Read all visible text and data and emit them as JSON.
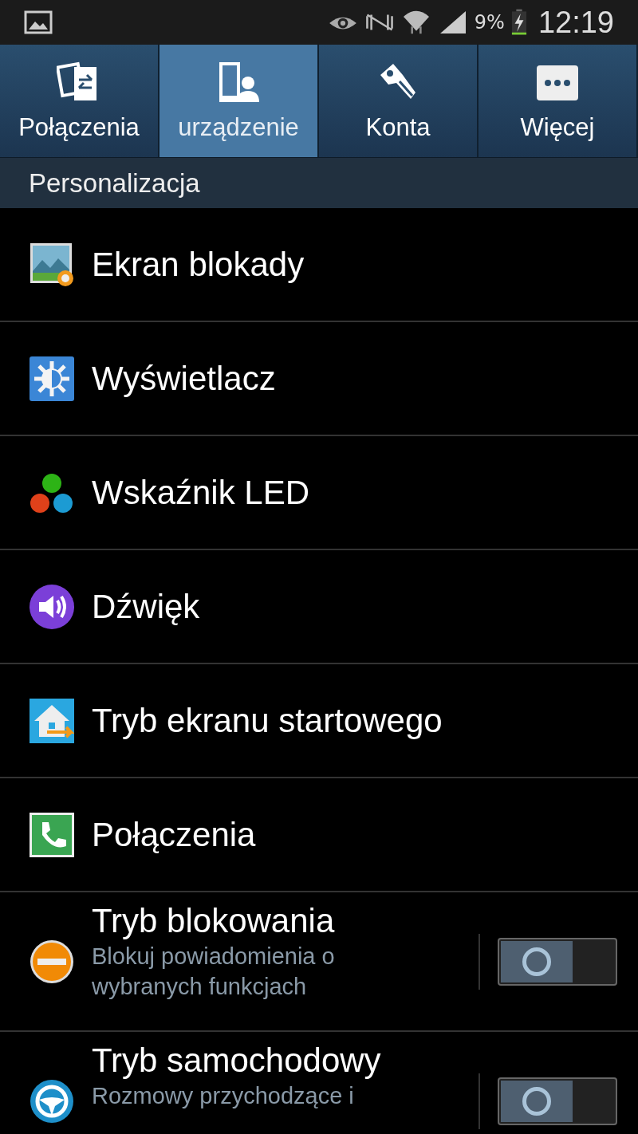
{
  "status_bar": {
    "battery": "9%",
    "time": "12:19"
  },
  "tabs": [
    {
      "label": "Połączenia",
      "selected": false
    },
    {
      "label": "urządzenie",
      "selected": true
    },
    {
      "label": "Konta",
      "selected": false
    },
    {
      "label": "Więcej",
      "selected": false
    }
  ],
  "section": "Personalizacja",
  "items": [
    {
      "kind": "link",
      "title": "Ekran blokady"
    },
    {
      "kind": "link",
      "title": "Wyświetlacz"
    },
    {
      "kind": "link",
      "title": "Wskaźnik LED"
    },
    {
      "kind": "link",
      "title": "Dźwięk"
    },
    {
      "kind": "link",
      "title": "Tryb ekranu startowego"
    },
    {
      "kind": "link",
      "title": "Połączenia"
    },
    {
      "kind": "toggle",
      "title": "Tryb blokowania",
      "subtitle": "Blokuj powiadomienia o wybranych funkcjach",
      "on": false
    },
    {
      "kind": "toggle",
      "title": "Tryb samochodowy",
      "subtitle": "Rozmowy przychodzące i",
      "on": false
    }
  ]
}
